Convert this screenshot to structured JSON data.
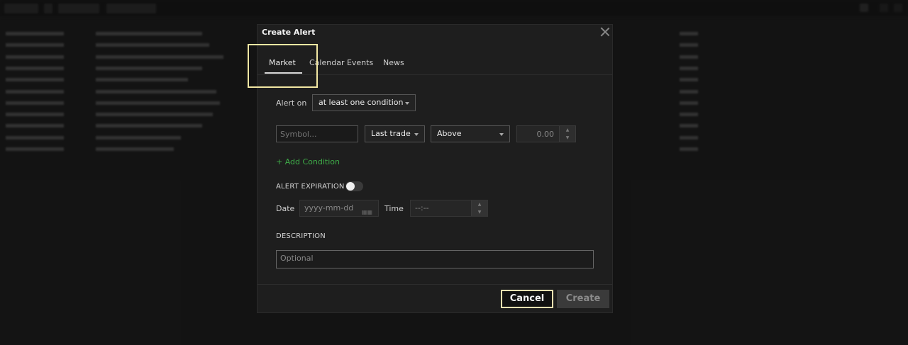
{
  "modal": {
    "title": "Create Alert",
    "tabs": [
      {
        "label": "Market",
        "active": true
      },
      {
        "label": "Calendar Events",
        "active": false
      },
      {
        "label": "News",
        "active": false
      }
    ],
    "alert_on_label": "Alert on",
    "alert_on_value": "at least one condition",
    "symbol_placeholder": "Symbol...",
    "field_value": "Last trade",
    "operator_value": "Above",
    "threshold_value": "0.00",
    "add_condition": "+ Add Condition",
    "expiration_label": "ALERT EXPIRATION",
    "expiration_enabled": false,
    "date_label": "Date",
    "date_placeholder": "yyyy-mm-dd",
    "time_label": "Time",
    "time_placeholder": "--:--",
    "description_label": "DESCRIPTION",
    "description_placeholder": "Optional",
    "cancel_label": "Cancel",
    "create_label": "Create"
  },
  "colors": {
    "add_condition": "#3fae49",
    "highlight": "#f2e7a3",
    "modal_bg": "#1e1e1e"
  }
}
